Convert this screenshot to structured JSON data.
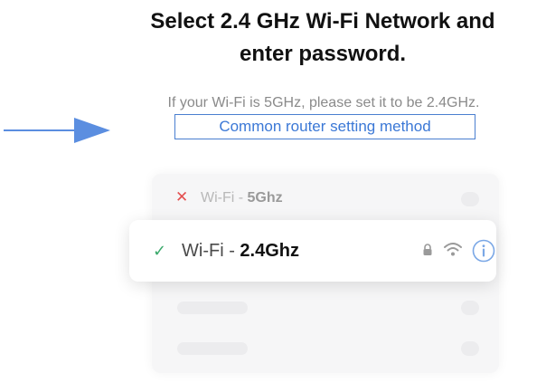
{
  "header": {
    "title_line1": "Select 2.4 GHz Wi-Fi Network and",
    "title_line2": "enter password.",
    "subtitle": "If your Wi-Fi is 5GHz, please set it to be 2.4GHz.",
    "router_link": "Common router setting method"
  },
  "networks": [
    {
      "status_icon": "x-icon",
      "status_symbol": "✕",
      "prefix": "Wi-Fi - ",
      "band": "5Ghz",
      "status_color": "#e45050"
    },
    {
      "status_icon": "check-icon",
      "status_symbol": "✓",
      "prefix": "Wi-Fi - ",
      "band": "2.4Ghz",
      "status_color": "#3aa96b",
      "icons": [
        "lock-icon",
        "wifi-icon",
        "info-icon"
      ]
    }
  ],
  "colors": {
    "link": "#3b78d6",
    "arrow": "#5b8ee0"
  }
}
